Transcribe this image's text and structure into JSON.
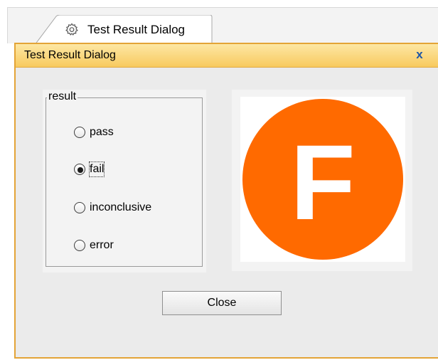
{
  "tab": {
    "label": "Test Result Dialog",
    "icon": "gear-icon"
  },
  "dialog": {
    "title": "Test Result Dialog",
    "close_glyph": "x",
    "title_bar_color": "#f8ca5f",
    "close_color": "#1c55a6"
  },
  "result_group": {
    "legend": "result",
    "options": [
      {
        "label": "pass",
        "selected": false
      },
      {
        "label": "fail",
        "selected": true
      },
      {
        "label": "inconclusive",
        "selected": false
      },
      {
        "label": "error",
        "selected": false
      }
    ]
  },
  "result_badge": {
    "letter": "F",
    "color": "#ff6a00"
  },
  "buttons": {
    "close_label": "Close"
  }
}
